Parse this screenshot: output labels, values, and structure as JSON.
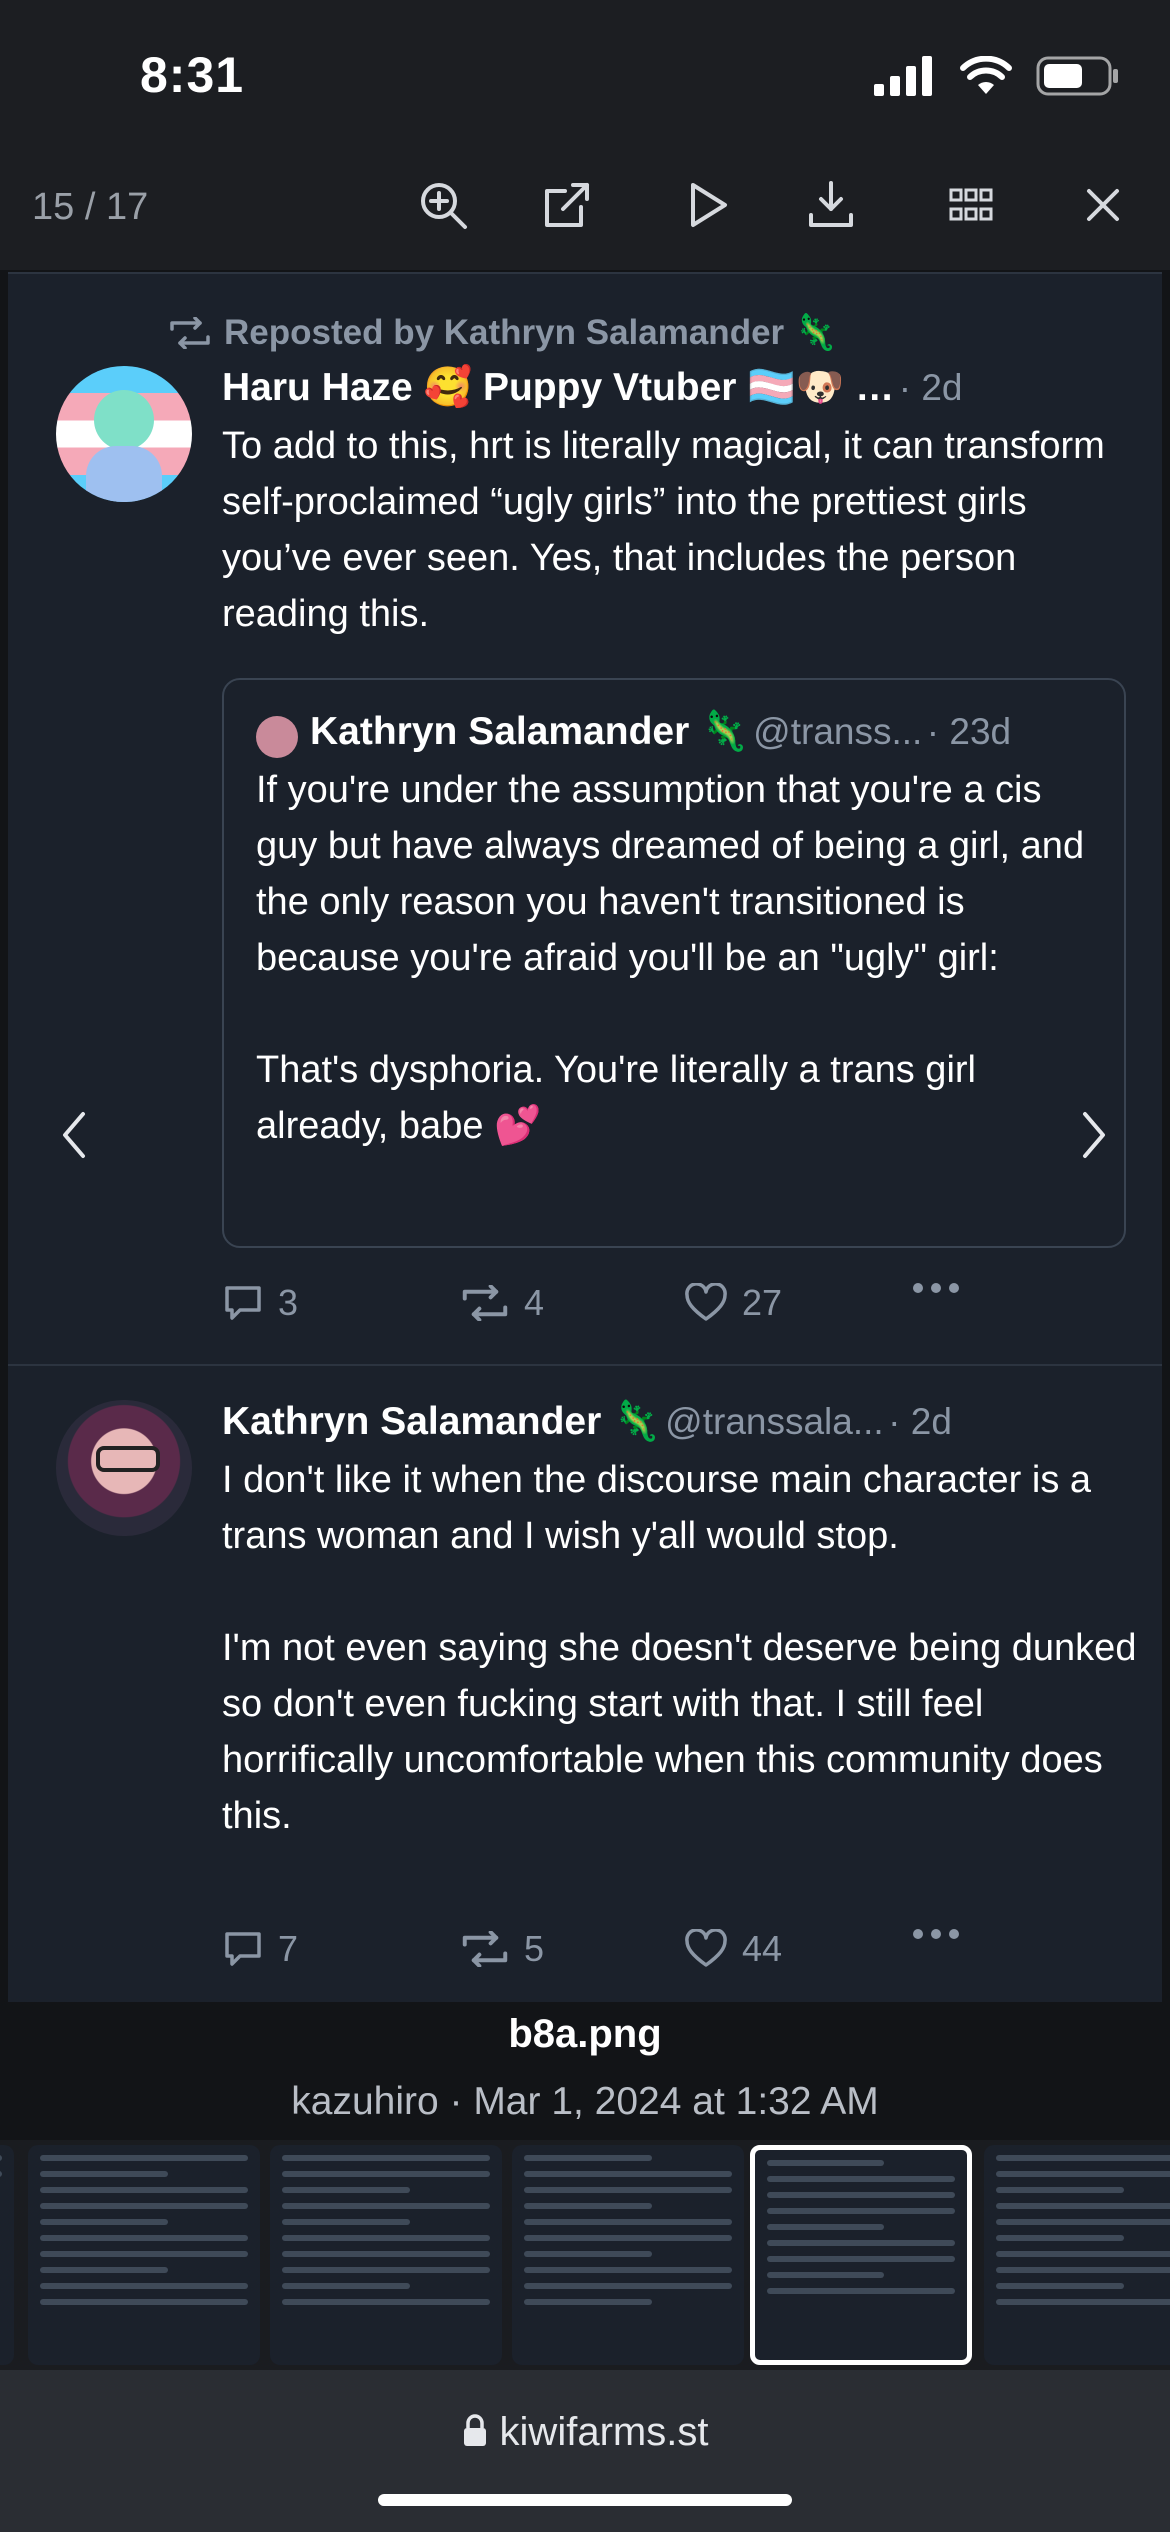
{
  "status_bar": {
    "time": "8:31"
  },
  "viewer": {
    "page_counter": "15 / 17",
    "toolbar_icons": [
      "zoom-in-icon",
      "open-external-icon",
      "play-icon",
      "download-icon",
      "grid-icon",
      "close-icon"
    ]
  },
  "tweet1": {
    "repost_label": "Reposted by Kathryn Salamander 🦎",
    "author": "Haru Haze 🥰 Puppy Vtuber 🏳️‍⚧️🐶 …",
    "time": "· 2d",
    "text": "To add to this, hrt is literally magical, it can transform self-proclaimed “ugly girls” into the prettiest girls you’ve ever seen. Yes, that includes the person reading this.",
    "quote": {
      "author": "Kathryn Salamander 🦎",
      "handle": "@transs...",
      "time": "· 23d",
      "text": "If you're under the assumption that you're a cis guy but have always dreamed of being a girl, and the only reason you haven't transitioned is because you're afraid you'll be an \"ugly\" girl:\n\nThat's dysphoria. You're literally a trans girl already, babe 💕"
    },
    "replies": "3",
    "reposts": "4",
    "likes": "27"
  },
  "tweet2": {
    "author": "Kathryn Salamander 🦎",
    "handle": "@transsala...",
    "time": "· 2d",
    "text": "I don't like it when the discourse main character is a trans woman and I wish y'all would stop.\n\nI'm not even saying she doesn't deserve being dunked so don't even fucking start with that. I still feel horrifically uncomfortable when this community does this.",
    "replies": "7",
    "reposts": "5",
    "likes": "44"
  },
  "caption": {
    "filename": "b8a.png",
    "meta": "kazuhiro · Mar 1, 2024 at 1:32 AM"
  },
  "url_bar": {
    "url": "kiwifarms.st"
  },
  "colors": {
    "background": "#121417",
    "post_bg": "#1b212b",
    "muted": "#8b96a5",
    "accent_heart": "#e0307a"
  }
}
